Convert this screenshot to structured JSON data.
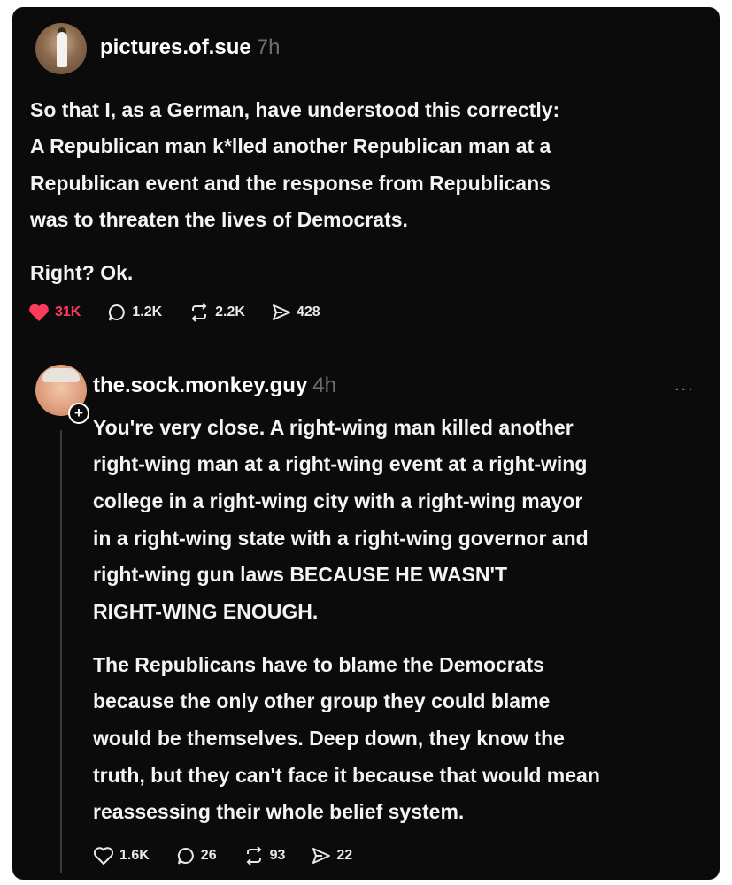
{
  "post": {
    "username": "pictures.of.sue",
    "time": "7h",
    "lines": [
      "So that I, as a German, have understood this correctly:",
      "A Republican man k*lled another Republican man at a",
      "Republican event and the response from Republicans",
      "was to threaten the lives of Democrats."
    ],
    "line_extra": "Right? Ok.",
    "likes": "31K",
    "comments": "1.2K",
    "reposts": "2.2K",
    "shares": "428",
    "like_color": "#ff3b5c"
  },
  "reply": {
    "username": "the.sock.monkey.guy",
    "time": "4h",
    "more": "...",
    "para1": [
      "You're very close. A right-wing man killed another",
      "right-wing man at a right-wing event at a right-wing",
      "college in a right-wing city with a right-wing mayor",
      "in a right-wing state with a right-wing governor and",
      "right-wing gun laws BECAUSE HE WASN'T",
      "RIGHT-WING ENOUGH."
    ],
    "para2": [
      "The Republicans have to blame the Democrats",
      "because the only other group they could blame",
      "would be themselves. Deep down, they know the",
      "truth, but they can't face it because that would mean",
      "reassessing their whole belief system."
    ],
    "likes": "1.6K",
    "comments": "26",
    "reposts": "93",
    "shares": "22"
  },
  "icons": [
    "heart-icon",
    "comment-icon",
    "repost-icon",
    "share-icon",
    "more-icon",
    "follow-plus-icon"
  ]
}
